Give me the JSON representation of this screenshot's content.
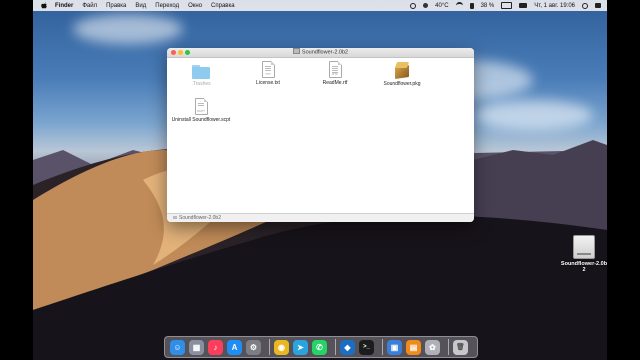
{
  "menubar": {
    "apple": "",
    "items": [
      "Finder",
      "Файл",
      "Правка",
      "Вид",
      "Переход",
      "Окно",
      "Справка"
    ],
    "status": {
      "temperature": "40°C",
      "battery": "38 %",
      "datetime": "Чт, 1 авг. 19:06"
    }
  },
  "window": {
    "title": "Soundflower-2.0b2",
    "status_path": "Soundflower-2.0b2",
    "files": [
      {
        "name": ".Trashes",
        "kind": "folder",
        "dim": true
      },
      {
        "name": "License.txt",
        "kind": "doc",
        "ext": "TXT"
      },
      {
        "name": "ReadMe.rtf",
        "kind": "doc",
        "ext": "RTF"
      },
      {
        "name": "Soundflower.pkg",
        "kind": "pkg"
      },
      {
        "name": "Uninstall Soundflower.scpt",
        "kind": "doc",
        "ext": "SCPT"
      }
    ]
  },
  "desktop_disk": {
    "line1": "Soundflower-2.0b",
    "line2": "2"
  },
  "dock": {
    "apps": [
      {
        "icon": "finder-icon",
        "color": "#2f8ee8"
      },
      {
        "icon": "launchpad-icon",
        "color": "#8a8fa0"
      },
      {
        "icon": "music-icon",
        "color": "#fb3e5c"
      },
      {
        "icon": "app-store-icon",
        "color": "#1e8ef5"
      },
      {
        "icon": "system-preferences-icon",
        "color": "#7d7d85"
      },
      {
        "icon": "chrome-icon",
        "color": "#e9b820"
      },
      {
        "icon": "telegram-icon",
        "color": "#2aa3df"
      },
      {
        "icon": "whatsapp-icon",
        "color": "#25d366"
      },
      {
        "icon": "vscode-icon",
        "color": "#1b6ec2"
      },
      {
        "icon": "terminal-icon",
        "color": "#1c1c1c"
      },
      {
        "icon": "preview-icon",
        "color": "#3c7fd8"
      },
      {
        "icon": "books-icon",
        "color": "#f18a1d"
      },
      {
        "icon": "photos-icon",
        "color": "#b0b0b8"
      },
      {
        "icon": "trash-icon",
        "color": "#c8c8cc"
      }
    ]
  }
}
